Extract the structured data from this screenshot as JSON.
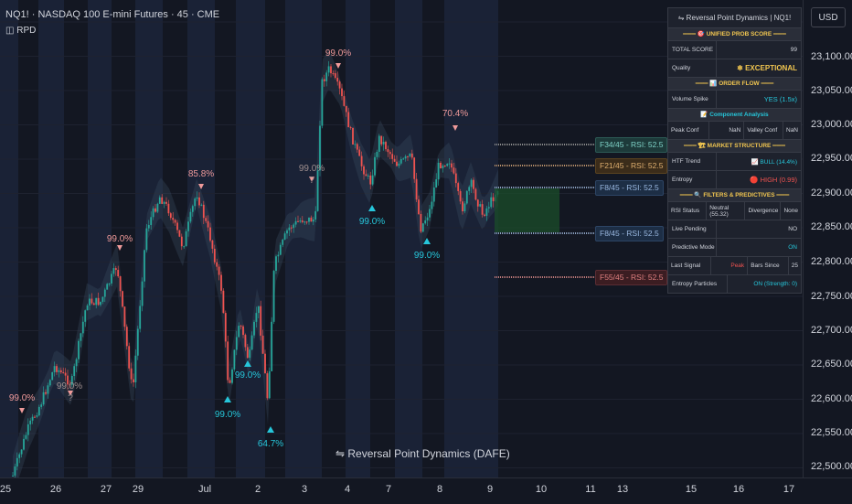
{
  "header": {
    "symbol_line": "NQ1! · NASDAQ 100 E-mini Futures · 45 · CME",
    "indicator_short": "RPD"
  },
  "currency_button": "USD",
  "y_axis": {
    "ticks": [
      "23,100.00",
      "23,050.00",
      "23,000.00",
      "22,950.00",
      "22,900.00",
      "22,850.00",
      "22,800.00",
      "22,750.00",
      "22,700.00",
      "22,650.00",
      "22,600.00",
      "22,550.00",
      "22,500.00"
    ]
  },
  "x_axis": {
    "ticks": [
      "25",
      "26",
      "27",
      "29",
      "Jul",
      "2",
      "3",
      "4",
      "7",
      "8",
      "9",
      "10",
      "11",
      "13",
      "15",
      "16",
      "17"
    ]
  },
  "pivot_labels": [
    "99.0%",
    "99.0%",
    "99.0%",
    "85.8%",
    "99.0%",
    "99.0%",
    "64.7%",
    "99.0%",
    "99.0%",
    "99.0%",
    "99.0%",
    "70.4%"
  ],
  "question_marks": [
    "?",
    "?"
  ],
  "fib_labels": [
    "F34/45 - RSI: 52.5",
    "F21/45 - RSI: 52.5",
    "F8/45 - RSI: 52.5",
    "F8/45 - RSI: 52.5",
    "F55/45 - RSI: 52.5"
  ],
  "watermark": "⇋ Reversal Point Dynamics (DAFE)",
  "colors": {
    "bull": "#26a69a",
    "bear": "#ef5350",
    "teal": "#26c6da",
    "gold": "#f0c550",
    "background": "#131722"
  },
  "panel": {
    "title": "⇋ Reversal Point Dynamics  | NQ1!",
    "sec_unified": "═══ 🎯 UNIFIED PROB SCORE ═══",
    "total_score_label": "TOTAL SCORE",
    "total_score_value": "99",
    "quality_label": "Quality",
    "quality_value": "❄ EXCEPTIONAL",
    "sec_orderflow": "═══ 📊 ORDER FLOW ═══",
    "volume_spike_label": "Volume Spike",
    "volume_spike_value": "YES (1.5x)",
    "component_analysis": "📝 Component Analysis",
    "peak_conf_label": "Peak Conf",
    "peak_conf_value": "NaN",
    "valley_conf_label": "Valley Conf",
    "valley_conf_value": "NaN",
    "sec_structure": "═══ 🏗 MARKET STRUCTURE ═══",
    "htf_trend_label": "HTF Trend",
    "htf_trend_value": "📈 BULL (14.4%)",
    "entropy_label": "Entropy",
    "entropy_value": "🔴 HIGH (0.99)",
    "sec_filters": "═══ 🔍 FILTERS & PREDICTIVES ═══",
    "rsi_status_label": "RSI Status",
    "rsi_status_value": "Neutral (55.32)",
    "divergence_label": "Divergence",
    "divergence_value": "None",
    "live_pending_label": "Live Pending",
    "live_pending_value": "NO",
    "predictive_mode_label": "Predictive Mode",
    "predictive_mode_value": "ON",
    "last_signal_label": "Last Signal",
    "last_signal_value": "Peak",
    "bars_since_label": "Bars Since",
    "bars_since_value": "25",
    "entropy_particles_label": "Entropy Particles",
    "entropy_particles_value": "ON (Strength: 0)"
  }
}
